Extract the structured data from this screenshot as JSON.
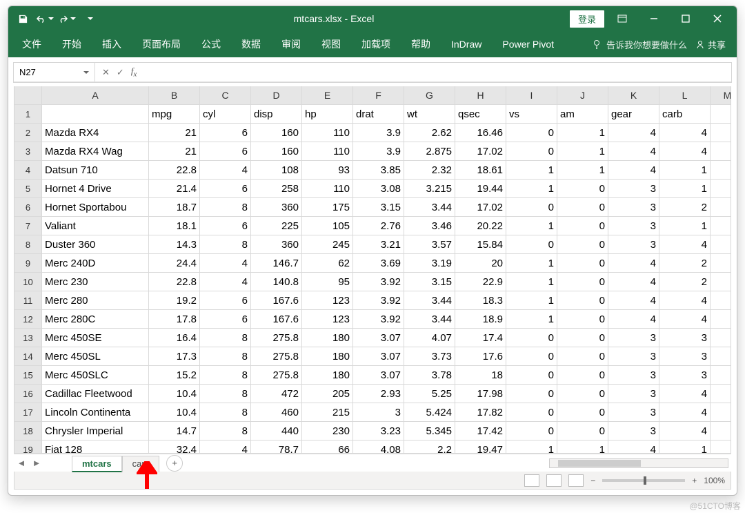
{
  "title": {
    "text": "mtcars.xlsx  -  Excel",
    "login": "登录"
  },
  "ribbon": {
    "tabs": [
      "文件",
      "开始",
      "插入",
      "页面布局",
      "公式",
      "数据",
      "审阅",
      "视图",
      "加载项",
      "帮助",
      "InDraw",
      "Power Pivot"
    ],
    "tellme": "告诉我你想要做什么",
    "share": "共享"
  },
  "formula_bar": {
    "cell_ref": "N27",
    "formula": ""
  },
  "columns": [
    "A",
    "B",
    "C",
    "D",
    "E",
    "F",
    "G",
    "H",
    "I",
    "J",
    "K",
    "L",
    "M"
  ],
  "headers": [
    "",
    "mpg",
    "cyl",
    "disp",
    "hp",
    "drat",
    "wt",
    "qsec",
    "vs",
    "am",
    "gear",
    "carb",
    ""
  ],
  "rows": [
    {
      "n": 2,
      "c": [
        "Mazda RX4",
        "21",
        "6",
        "160",
        "110",
        "3.9",
        "2.62",
        "16.46",
        "0",
        "1",
        "4",
        "4",
        ""
      ]
    },
    {
      "n": 3,
      "c": [
        "Mazda RX4 Wag",
        "21",
        "6",
        "160",
        "110",
        "3.9",
        "2.875",
        "17.02",
        "0",
        "1",
        "4",
        "4",
        ""
      ]
    },
    {
      "n": 4,
      "c": [
        "Datsun 710",
        "22.8",
        "4",
        "108",
        "93",
        "3.85",
        "2.32",
        "18.61",
        "1",
        "1",
        "4",
        "1",
        ""
      ]
    },
    {
      "n": 5,
      "c": [
        "Hornet 4 Drive",
        "21.4",
        "6",
        "258",
        "110",
        "3.08",
        "3.215",
        "19.44",
        "1",
        "0",
        "3",
        "1",
        ""
      ]
    },
    {
      "n": 6,
      "c": [
        "Hornet Sportabou",
        "18.7",
        "8",
        "360",
        "175",
        "3.15",
        "3.44",
        "17.02",
        "0",
        "0",
        "3",
        "2",
        ""
      ]
    },
    {
      "n": 7,
      "c": [
        "Valiant",
        "18.1",
        "6",
        "225",
        "105",
        "2.76",
        "3.46",
        "20.22",
        "1",
        "0",
        "3",
        "1",
        ""
      ]
    },
    {
      "n": 8,
      "c": [
        "Duster 360",
        "14.3",
        "8",
        "360",
        "245",
        "3.21",
        "3.57",
        "15.84",
        "0",
        "0",
        "3",
        "4",
        ""
      ]
    },
    {
      "n": 9,
      "c": [
        "Merc 240D",
        "24.4",
        "4",
        "146.7",
        "62",
        "3.69",
        "3.19",
        "20",
        "1",
        "0",
        "4",
        "2",
        ""
      ]
    },
    {
      "n": 10,
      "c": [
        "Merc 230",
        "22.8",
        "4",
        "140.8",
        "95",
        "3.92",
        "3.15",
        "22.9",
        "1",
        "0",
        "4",
        "2",
        ""
      ]
    },
    {
      "n": 11,
      "c": [
        "Merc 280",
        "19.2",
        "6",
        "167.6",
        "123",
        "3.92",
        "3.44",
        "18.3",
        "1",
        "0",
        "4",
        "4",
        ""
      ]
    },
    {
      "n": 12,
      "c": [
        "Merc 280C",
        "17.8",
        "6",
        "167.6",
        "123",
        "3.92",
        "3.44",
        "18.9",
        "1",
        "0",
        "4",
        "4",
        ""
      ]
    },
    {
      "n": 13,
      "c": [
        "Merc 450SE",
        "16.4",
        "8",
        "275.8",
        "180",
        "3.07",
        "4.07",
        "17.4",
        "0",
        "0",
        "3",
        "3",
        ""
      ]
    },
    {
      "n": 14,
      "c": [
        "Merc 450SL",
        "17.3",
        "8",
        "275.8",
        "180",
        "3.07",
        "3.73",
        "17.6",
        "0",
        "0",
        "3",
        "3",
        ""
      ]
    },
    {
      "n": 15,
      "c": [
        "Merc 450SLC",
        "15.2",
        "8",
        "275.8",
        "180",
        "3.07",
        "3.78",
        "18",
        "0",
        "0",
        "3",
        "3",
        ""
      ]
    },
    {
      "n": 16,
      "c": [
        "Cadillac Fleetwood",
        "10.4",
        "8",
        "472",
        "205",
        "2.93",
        "5.25",
        "17.98",
        "0",
        "0",
        "3",
        "4",
        ""
      ]
    },
    {
      "n": 17,
      "c": [
        "Lincoln Continenta",
        "10.4",
        "8",
        "460",
        "215",
        "3",
        "5.424",
        "17.82",
        "0",
        "0",
        "3",
        "4",
        ""
      ]
    },
    {
      "n": 18,
      "c": [
        "Chrysler Imperial",
        "14.7",
        "8",
        "440",
        "230",
        "3.23",
        "5.345",
        "17.42",
        "0",
        "0",
        "3",
        "4",
        ""
      ]
    },
    {
      "n": 19,
      "c": [
        "Fiat 128",
        "32.4",
        "4",
        "78.7",
        "66",
        "4.08",
        "2.2",
        "19.47",
        "1",
        "1",
        "4",
        "1",
        ""
      ]
    }
  ],
  "sheets": {
    "tabs": [
      "mtcars",
      "cars"
    ],
    "active": 0
  },
  "status": {
    "zoom": "100%"
  },
  "watermark": "@51CTO博客"
}
